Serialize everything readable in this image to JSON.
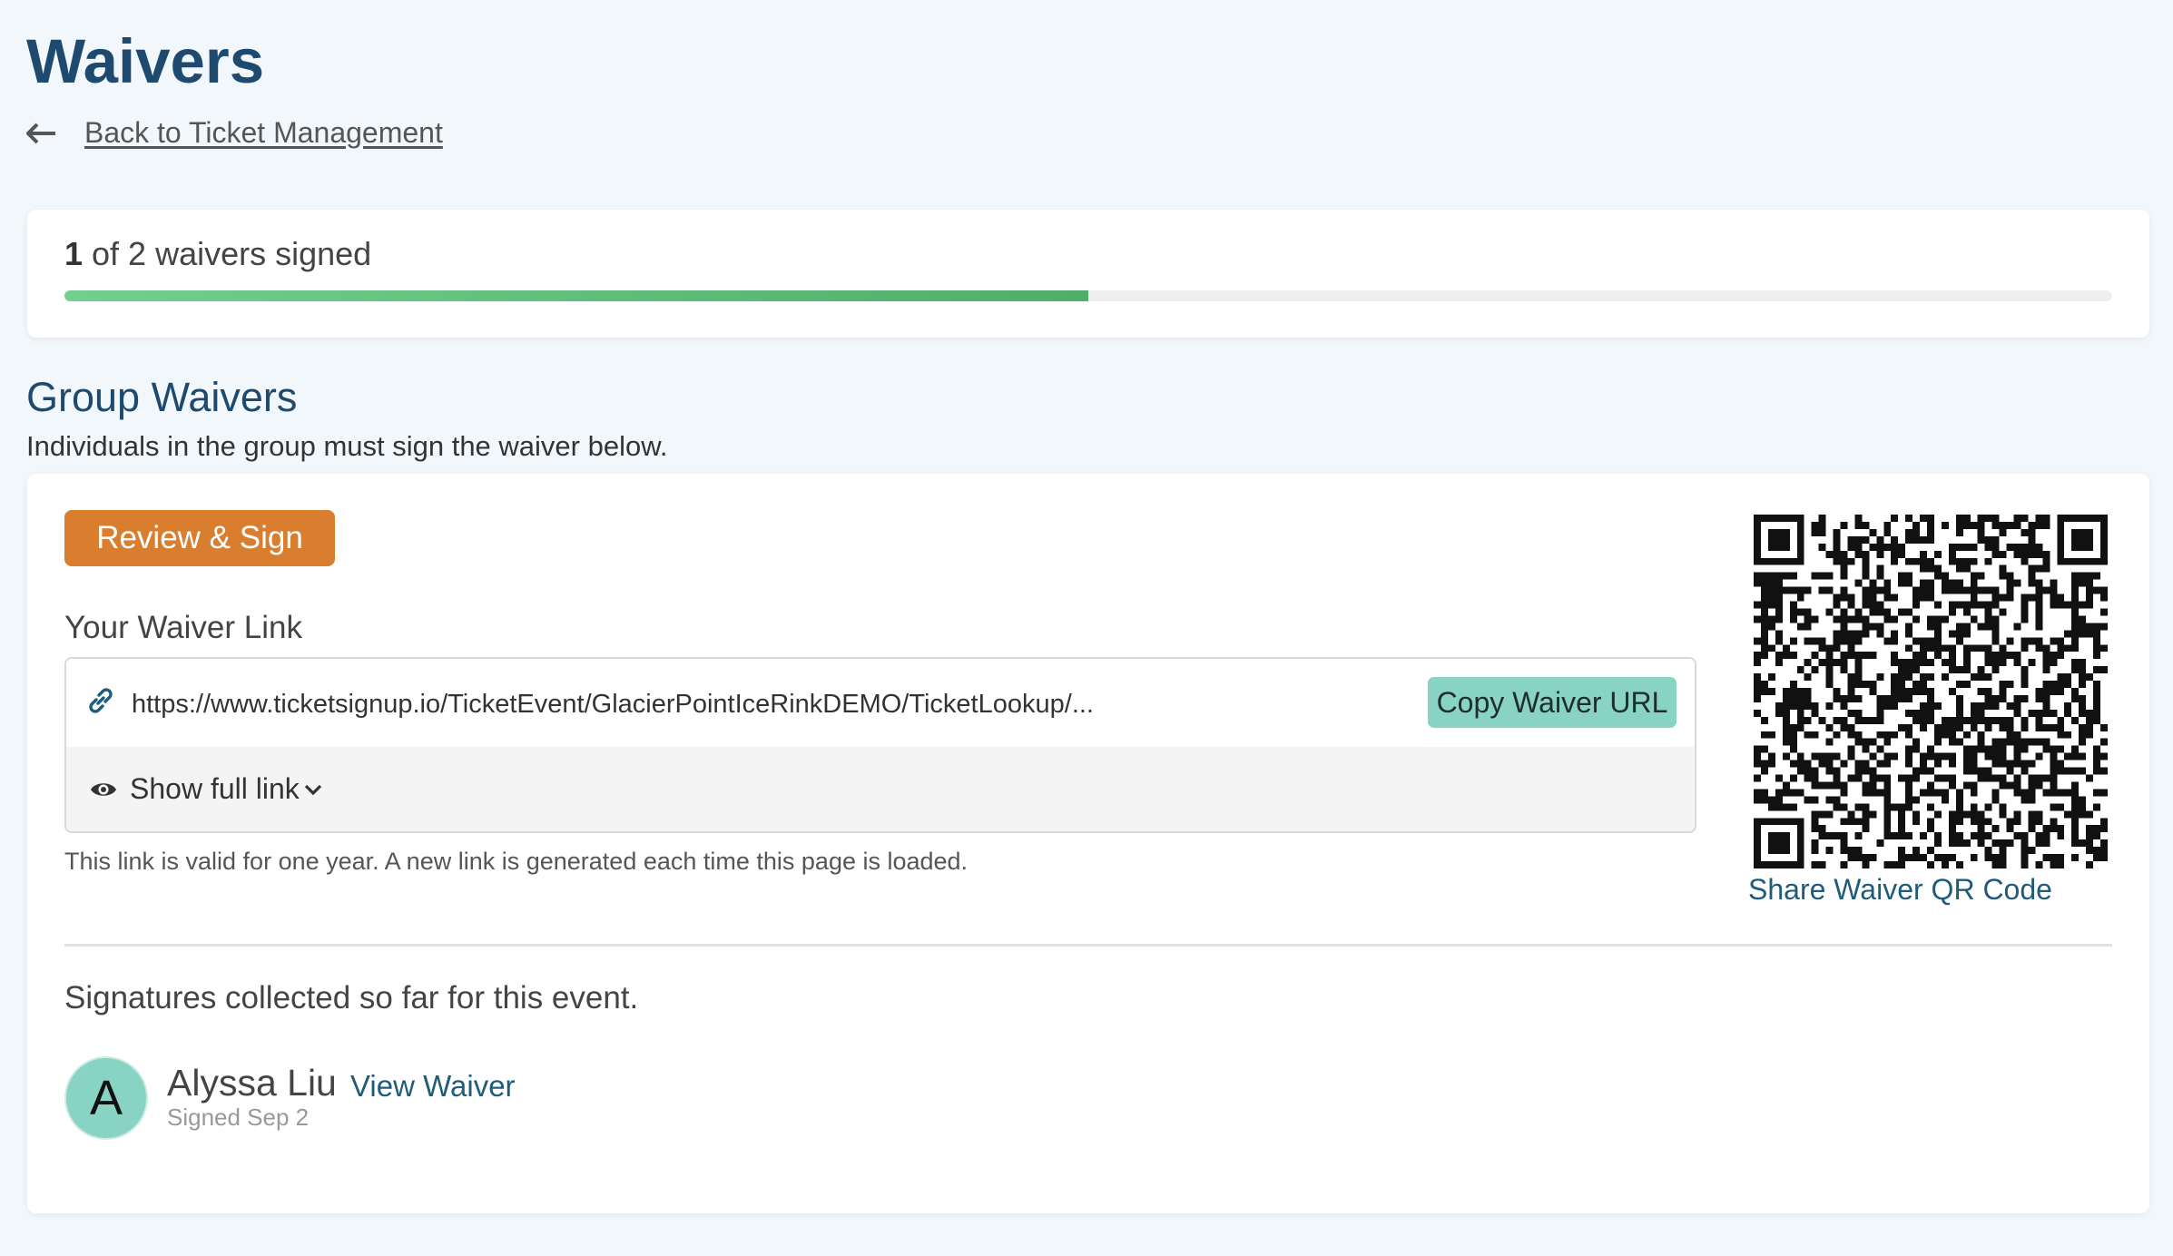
{
  "header": {
    "title": "Waivers",
    "back_label": "Back to Ticket Management"
  },
  "progress": {
    "signed_count": "1",
    "suffix": " of 2 waivers signed",
    "fraction": 0.5
  },
  "group": {
    "title": "Group Waivers",
    "description": "Individuals in the group must sign the waiver below.",
    "review_button": "Review & Sign",
    "link_label": "Your Waiver Link",
    "link_url": "https://www.ticketsignup.io/TicketEvent/GlacierPointIceRinkDEMO/TicketLookup/...",
    "copy_button": "Copy Waiver URL",
    "show_full_link": "Show full link",
    "link_note": "This link is valid for one year. A new link is generated each time this page is loaded.",
    "qr_label": "Share Waiver QR Code"
  },
  "signatures": {
    "heading": "Signatures collected so far for this event.",
    "items": [
      {
        "initial": "A",
        "name": "Alyssa Liu",
        "view_label": "View Waiver",
        "signed": "Signed Sep 2"
      }
    ]
  },
  "icons": {
    "back": "arrow-left-icon",
    "link": "chain-link-icon",
    "show": "eye-icon",
    "expand": "chevron-down-icon"
  },
  "colors": {
    "title": "#1f4a70",
    "review_button": "#d97e2e",
    "copy_button": "#88d3c4",
    "progress_fill": "#4fae6a",
    "avatar": "#88d3c4",
    "link": "#1f5c7a"
  }
}
